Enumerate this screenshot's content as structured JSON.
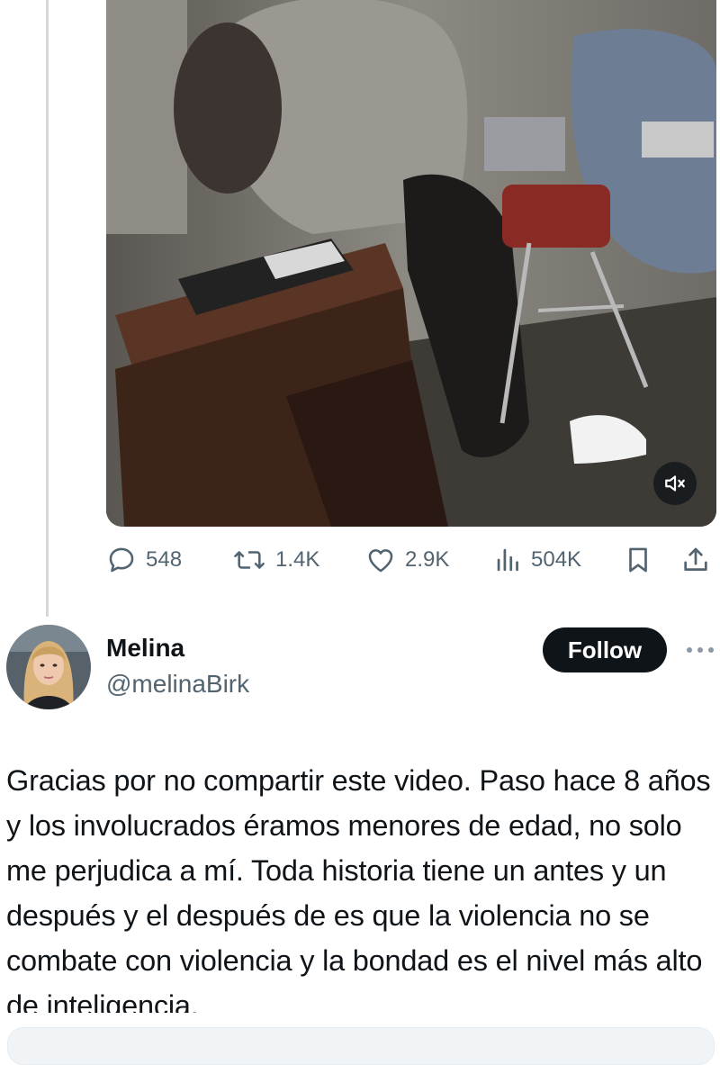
{
  "post": {
    "stats": {
      "replies": "548",
      "reposts": "1.4K",
      "likes": "2.9K",
      "views": "504K"
    }
  },
  "author": {
    "display_name": "Melina",
    "handle": "@melinaBirk",
    "follow_label": "Follow"
  },
  "reply": {
    "text": "Gracias por no compartir este video. Paso hace 8 años y los involucrados éramos menores de edad, no solo me perjudica a mí. Toda historia tiene un antes y un después y el después de es que la violencia no se combate con violencia y la bondad es el nivel más alto de inteligencia."
  },
  "icons": {
    "reply": "reply-icon",
    "repost": "repost-icon",
    "like": "heart-icon",
    "views": "views-icon",
    "bookmark": "bookmark-icon",
    "share": "share-icon",
    "mute": "muted-speaker-icon",
    "more": "more-icon"
  },
  "colors": {
    "text": "#0f1419",
    "secondary": "#536471",
    "follow_bg": "#0f1419",
    "thread_line": "#cfd9de"
  }
}
